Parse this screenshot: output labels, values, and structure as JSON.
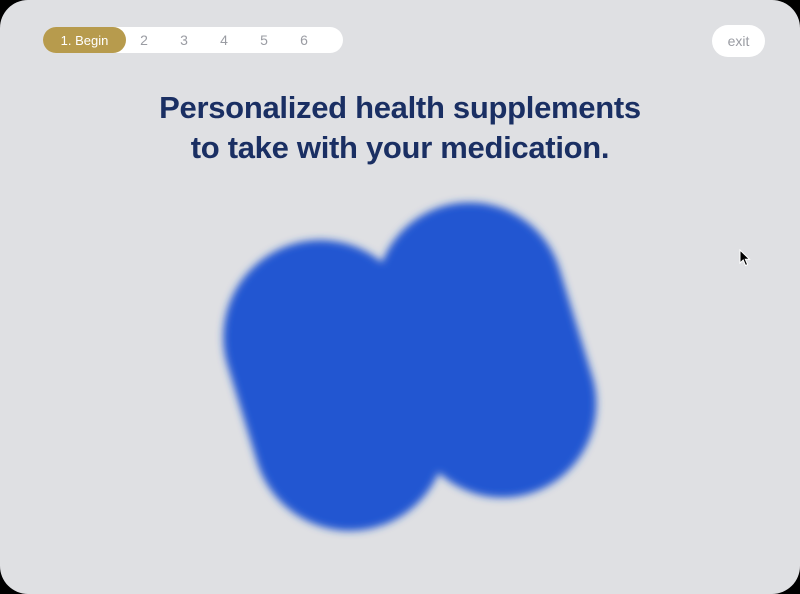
{
  "progress": {
    "active_step": "1. Begin",
    "steps": [
      "2",
      "3",
      "4",
      "5",
      "6"
    ]
  },
  "exit_label": "exit",
  "headline": {
    "line1": "Personalized health supplements",
    "line2": "to take with your medication."
  },
  "colors": {
    "background": "#dfe0e3",
    "accent_gold": "#b79b4d",
    "headline_navy": "#1a2f63",
    "pill_blue": "#2457d1"
  },
  "icons": {
    "pill_graphic": "blurred-pill-icon",
    "cursor": "mouse-cursor-icon"
  }
}
